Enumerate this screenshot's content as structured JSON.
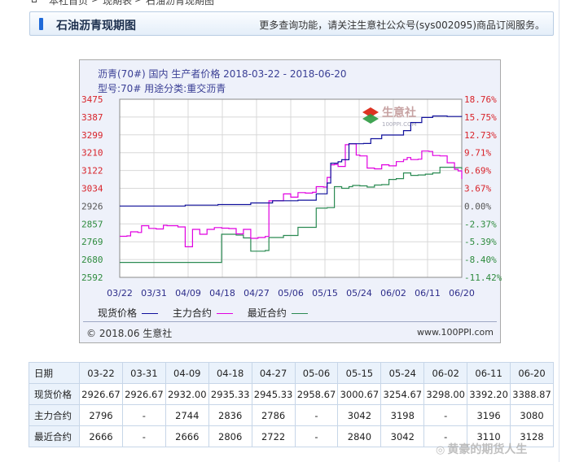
{
  "breadcrumb": {
    "items": [
      "本社首页",
      "现期表",
      "石油沥青现期图"
    ]
  },
  "header": {
    "title": "石油沥青现期图",
    "notice": "更多查询功能，请关注生意社公众号(sys002095)商品订阅服务。"
  },
  "chart_data": {
    "type": "line",
    "title": "沥青(70#) 国内 生产者价格 2018-03-22 - 2018-06-20",
    "subtitle": "型号:70# 用途分类:重交沥青",
    "x_ticks": [
      "03/22",
      "03/31",
      "04/09",
      "04/18",
      "04/27",
      "05/06",
      "05/15",
      "05/24",
      "06/02",
      "06/11",
      "06/20"
    ],
    "ylim": [
      2592,
      3475
    ],
    "y_ticks_left": [
      "3475",
      "3387",
      "3299",
      "3210",
      "3122",
      "3034",
      "2926",
      "2857",
      "2769",
      "2680",
      "2592"
    ],
    "y_ticks_right": [
      "18.76%",
      "15.75%",
      "12.73%",
      "9.71%",
      "6.69%",
      "3.67%",
      "0.00%",
      "-2.37%",
      "-5.39%",
      "-8.40%",
      "-11.42%"
    ],
    "series": [
      {
        "name": "现货价格",
        "color": "#10109c",
        "points": [
          [
            0,
            2926.67
          ],
          [
            9,
            2926.67
          ],
          [
            18,
            2932.0
          ],
          [
            27,
            2935.33
          ],
          [
            36,
            2945.33
          ],
          [
            42,
            2958.67
          ],
          [
            49,
            2962
          ],
          [
            54,
            3000.67
          ],
          [
            57,
            3060
          ],
          [
            58,
            3158
          ],
          [
            60,
            3165
          ],
          [
            61,
            3175
          ],
          [
            63,
            3254.67
          ],
          [
            67,
            3256
          ],
          [
            69,
            3280
          ],
          [
            72,
            3298.0
          ],
          [
            78,
            3320
          ],
          [
            80,
            3360
          ],
          [
            83,
            3385
          ],
          [
            86,
            3392.2
          ],
          [
            90,
            3390
          ],
          [
            94,
            3388.87
          ]
        ]
      },
      {
        "name": "主力合约",
        "color": "#e000e0",
        "points": [
          [
            0,
            2796
          ],
          [
            2,
            2798
          ],
          [
            3,
            2818
          ],
          [
            5,
            2815
          ],
          [
            6,
            2848
          ],
          [
            8,
            2835
          ],
          [
            10,
            2832
          ],
          [
            12,
            2850
          ],
          [
            13,
            2848
          ],
          [
            16,
            2842
          ],
          [
            18,
            2744
          ],
          [
            20,
            2830
          ],
          [
            22,
            2806
          ],
          [
            24,
            2830
          ],
          [
            26,
            2839
          ],
          [
            28,
            2836
          ],
          [
            30,
            2834
          ],
          [
            32,
            2808
          ],
          [
            34,
            2830
          ],
          [
            36,
            2786
          ],
          [
            38,
            2790
          ],
          [
            40,
            2795
          ],
          [
            41,
            2958
          ],
          [
            44,
            2958
          ],
          [
            45,
            3000
          ],
          [
            47,
            2980
          ],
          [
            49,
            3008
          ],
          [
            51,
            3005
          ],
          [
            53,
            3010
          ],
          [
            54,
            3042
          ],
          [
            56,
            3040
          ],
          [
            57,
            3088
          ],
          [
            58,
            3150
          ],
          [
            59,
            3152
          ],
          [
            60,
            3142
          ],
          [
            62,
            3250
          ],
          [
            63,
            3254
          ],
          [
            65,
            3198
          ],
          [
            66,
            3194
          ],
          [
            68,
            3134
          ],
          [
            70,
            3130
          ],
          [
            72,
            3150
          ],
          [
            74,
            3145
          ],
          [
            76,
            3166
          ],
          [
            78,
            3176
          ],
          [
            79,
            3186
          ],
          [
            80,
            3176
          ],
          [
            82,
            3178
          ],
          [
            83,
            3218
          ],
          [
            85,
            3216
          ],
          [
            86,
            3196
          ],
          [
            88,
            3194
          ],
          [
            90,
            3160
          ],
          [
            92,
            3128
          ],
          [
            93,
            3120
          ],
          [
            94,
            3080
          ]
        ]
      },
      {
        "name": "最近合约",
        "color": "#2a8a52",
        "points": [
          [
            0,
            2666
          ],
          [
            9,
            2666
          ],
          [
            18,
            2666
          ],
          [
            27,
            2666
          ],
          [
            28,
            2806
          ],
          [
            30,
            2806
          ],
          [
            32,
            2802
          ],
          [
            34,
            2788
          ],
          [
            36,
            2722
          ],
          [
            38,
            2722
          ],
          [
            40,
            2725
          ],
          [
            41,
            2790
          ],
          [
            45,
            2800
          ],
          [
            49,
            2840
          ],
          [
            53,
            2840
          ],
          [
            54,
            2918
          ],
          [
            57,
            2920
          ],
          [
            59,
            3042
          ],
          [
            61,
            3034
          ],
          [
            63,
            3042
          ],
          [
            64,
            3048
          ],
          [
            66,
            3046
          ],
          [
            68,
            3040
          ],
          [
            70,
            3050
          ],
          [
            72,
            3052
          ],
          [
            74,
            3078
          ],
          [
            76,
            3082
          ],
          [
            78,
            3110
          ],
          [
            80,
            3098
          ],
          [
            82,
            3100
          ],
          [
            84,
            3104
          ],
          [
            86,
            3110
          ],
          [
            88,
            3138
          ],
          [
            92,
            3136
          ],
          [
            94,
            3128
          ]
        ]
      }
    ]
  },
  "chart_footer": {
    "left": "2018.06 生意社",
    "right": "www.100PPI.com"
  },
  "logo_text": "生意社",
  "logo_url_text": "100PPI.COM",
  "table": {
    "columns": [
      "日期",
      "03-22",
      "03-31",
      "04-09",
      "04-18",
      "04-27",
      "05-06",
      "05-15",
      "05-24",
      "06-02",
      "06-11",
      "06-20"
    ],
    "rows": [
      [
        "现货价格",
        "2926.67",
        "2926.67",
        "2932.00",
        "2935.33",
        "2945.33",
        "2958.67",
        "3000.67",
        "3254.67",
        "3298.00",
        "3392.20",
        "3388.87"
      ],
      [
        "主力合约",
        "2796",
        "-",
        "2744",
        "2836",
        "2786",
        "-",
        "3042",
        "3198",
        "-",
        "3196",
        "3080"
      ],
      [
        "最近合约",
        "2666",
        "-",
        "2666",
        "2806",
        "2722",
        "-",
        "2840",
        "3042",
        "-",
        "3110",
        "3128"
      ]
    ]
  },
  "watermark": {
    "text": "黄豪的期货人生",
    "icon": "weibo-icon"
  }
}
